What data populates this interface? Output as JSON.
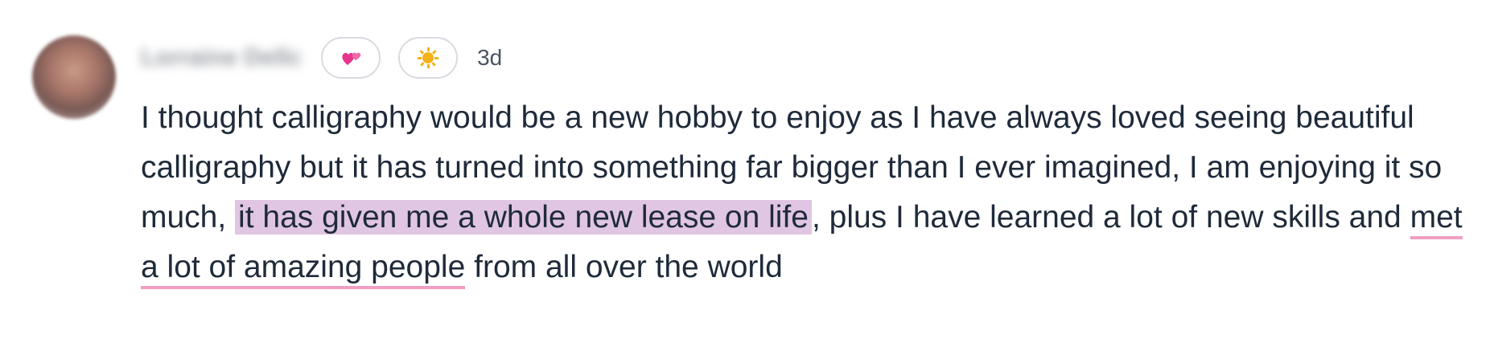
{
  "comment": {
    "author": "Lorraine Dellc",
    "reactions": [
      {
        "emoji": "💕",
        "icon": "two-hearts-icon",
        "color": "#e8358c"
      },
      {
        "emoji": "☀️",
        "icon": "sun-icon",
        "color": "#f6b21a"
      }
    ],
    "timestamp": "3d",
    "text": {
      "part1": "I thought calligraphy would be a new hobby to enjoy as I have always loved seeing beautiful calligraphy but it has turned into something far bigger than I ever imagined, I am enjoying it so much,",
      "highlight": "it has given me a whole new lease on life",
      "part2": ", plus I have learned a lot of new skills and",
      "underline": "met a lot of amazing people",
      "part3": "from all over the world"
    },
    "colors": {
      "highlight": "#e0c6e2",
      "underline": "#ef9fc1",
      "text": "#1f2a3a"
    }
  }
}
